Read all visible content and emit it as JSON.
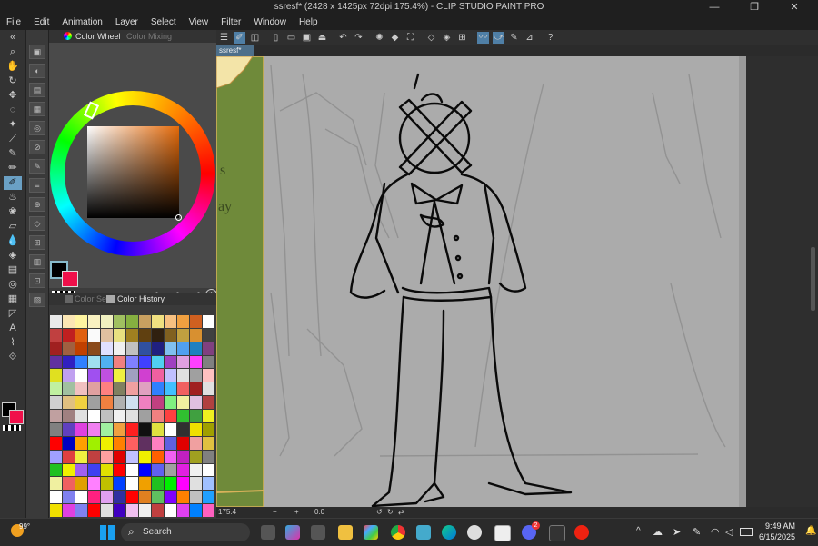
{
  "window": {
    "title": "ssresf* (2428 x 1425px 72dpi 175.4%) - CLIP STUDIO PAINT PRO",
    "minimize": "—",
    "maximize": "❐",
    "close": "✕"
  },
  "menu": [
    "File",
    "Edit",
    "Animation",
    "Layer",
    "Select",
    "View",
    "Filter",
    "Window",
    "Help"
  ],
  "panel": {
    "tab_color_wheel": "Color Wheel",
    "tab_color_mixing": "Color Mixing",
    "tab_color_set": "Color Set",
    "tab_color_history": "Color History",
    "r_value": "0",
    "g_value": "0",
    "b_value": "0"
  },
  "document": {
    "tab_name": "ssresf*",
    "zoom": "175.4",
    "rotation": "0.0"
  },
  "taskbar": {
    "weather_temp": "99°",
    "search_label": "Search",
    "time": "9:49 AM",
    "date": "6/15/2025",
    "discord_badge": "2"
  },
  "swatches": [
    "#e9e9e9",
    "#fbe6b4",
    "#fff5a0",
    "#f9f1c1",
    "#f0f0c0",
    "#a0c060",
    "#86b040",
    "#c8a060",
    "#f0e080",
    "#f7c080",
    "#f0a040",
    "#d06020",
    "#ffffff",
    "#c04040",
    "#c02020",
    "#e06010",
    "#fafafa",
    "#e0c0a0",
    "#e8e080",
    "#a08020",
    "#604010",
    "#302010",
    "#806020",
    "#c0a040",
    "#d89030",
    "#404040",
    "#a02020",
    "#a06040",
    "#c04000",
    "#8a4a1a",
    "#e0e0ff",
    "#f0f0f0",
    "#c0c0c0",
    "#3050a0",
    "#202080",
    "#80c0f0",
    "#50a0f0",
    "#2080c0",
    "#804080",
    "#6030a0",
    "#3020c0",
    "#3080ff",
    "#a0e0f0",
    "#50b0f0",
    "#f08080",
    "#8080ff",
    "#4040ff",
    "#50d0f0",
    "#a040c0",
    "#e0a0e0",
    "#ff40ff",
    "#808080",
    "#e0e020",
    "#c0a0f0",
    "#ffffff",
    "#a050f0",
    "#c050e0",
    "#f0f040",
    "#a0a0c0",
    "#d040d0",
    "#f060a0",
    "#c0c0ff",
    "#e0e0e0",
    "#a0a0a0",
    "#ffc0c0",
    "#c0f0a0",
    "#a0c0a0",
    "#f0c0c0",
    "#e0a0a0",
    "#ff8080",
    "#808060",
    "#f0a0a0",
    "#e0a0c0",
    "#3080ff",
    "#40c0ff",
    "#f06060",
    "#a02020",
    "#e0e0e0",
    "#d0d0d0",
    "#e0c080",
    "#f0d040",
    "#a0a0a0",
    "#f08040",
    "#b0b0b0",
    "#d0e0f0",
    "#f080c0",
    "#c04080",
    "#80f080",
    "#f0f0a0",
    "#e0c0e0",
    "#b04040",
    "#c0a0a0",
    "#a08080",
    "#e0e0e0",
    "#ffffff",
    "#c0c0c0",
    "#f0f0f0",
    "#e0e0e0",
    "#a0a0a0",
    "#f08080",
    "#ff4040",
    "#30c030",
    "#40a040",
    "#f0f020",
    "#808080",
    "#6040c0",
    "#e040e0",
    "#f080f0",
    "#a0f0a0",
    "#f0a040",
    "#ff2020",
    "#101010",
    "#e0e040",
    "#ffffff",
    "#303030",
    "#f0e000",
    "#a0a000",
    "#ff0000",
    "#0000c0",
    "#ffa000",
    "#a0f000",
    "#f0f000",
    "#ff8000",
    "#ff6060",
    "#603060",
    "#ff80c0",
    "#6060e0",
    "#e00000",
    "#f0a0a0",
    "#e0c040",
    "#a0a0ff",
    "#e04040",
    "#f0f040",
    "#c04040",
    "#ffa0a0",
    "#e00000",
    "#c0c0ff",
    "#f0f000",
    "#ff6000",
    "#f060f0",
    "#c020c0",
    "#a0a020",
    "#808080",
    "#20c020",
    "#f0f000",
    "#a060f0",
    "#4040f0",
    "#e0e000",
    "#ff0000",
    "#ffffff",
    "#0000ff",
    "#6060f0",
    "#a0a0a0",
    "#e020e0",
    "#f0f0f0",
    "#ffffff",
    "#f0f0a0",
    "#f06060",
    "#e0a000",
    "#ff80ff",
    "#c0c000",
    "#0040ff",
    "#ffffff",
    "#f0a000",
    "#20c020",
    "#00f000",
    "#ff00ff",
    "#e0e0e0",
    "#a0c0ff",
    "#ffffff",
    "#8080f0",
    "#ffffff",
    "#ff2080",
    "#e0a0f0",
    "#3030a0",
    "#ff0000",
    "#e08020",
    "#60c060",
    "#8000ff",
    "#ff8000",
    "#c0c0c0",
    "#20a0ff",
    "#f0e000",
    "#e040e0",
    "#8080f0",
    "#ff0000",
    "#e0e0e0",
    "#4000c0",
    "#f0c0f0",
    "#f0f0f0",
    "#c04040",
    "#ffffff",
    "#e040f0",
    "#0080ff",
    "#ff60c0"
  ]
}
